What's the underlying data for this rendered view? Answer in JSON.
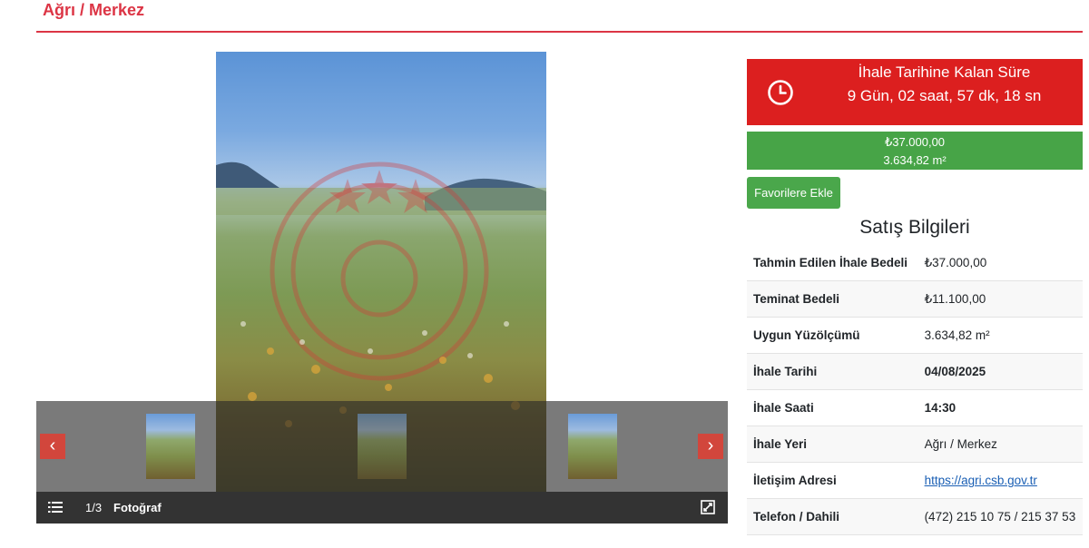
{
  "page": {
    "title": "Ağrı / Merkez"
  },
  "gallery": {
    "counter": "1/3",
    "label": "Fotoğraf",
    "prev_icon": "‹",
    "next_icon": "›"
  },
  "countdown": {
    "title": "İhale Tarihine Kalan Süre",
    "value": "9 Gün, 02 saat, 57 dk, 18 sn"
  },
  "price": {
    "amount": "₺37.000,00",
    "area": "3.634,82 m²"
  },
  "favorite_button": "Favorilere Ekle",
  "section_title": "Satış Bilgileri",
  "info": [
    {
      "key": "Tahmin Edilen İhale Bedeli",
      "value": "₺37.000,00"
    },
    {
      "key": "Teminat Bedeli",
      "value": "₺11.100,00"
    },
    {
      "key": "Uygun Yüzölçümü",
      "value": "3.634,82 m²"
    },
    {
      "key": "İhale Tarihi",
      "value": "04/08/2025"
    },
    {
      "key": "İhale Saati",
      "value": "14:30"
    },
    {
      "key": "İhale Yeri",
      "value": "Ağrı / Merkez"
    },
    {
      "key": "İletişim Adresi",
      "value": "https://agri.csb.gov.tr"
    },
    {
      "key": "Telefon / Dahili",
      "value": "(472) 215 10 75 / 215 37 53"
    }
  ],
  "colors": {
    "accent_red": "#dc3545",
    "countdown_red": "#dc1f1f",
    "green": "#47a447"
  }
}
